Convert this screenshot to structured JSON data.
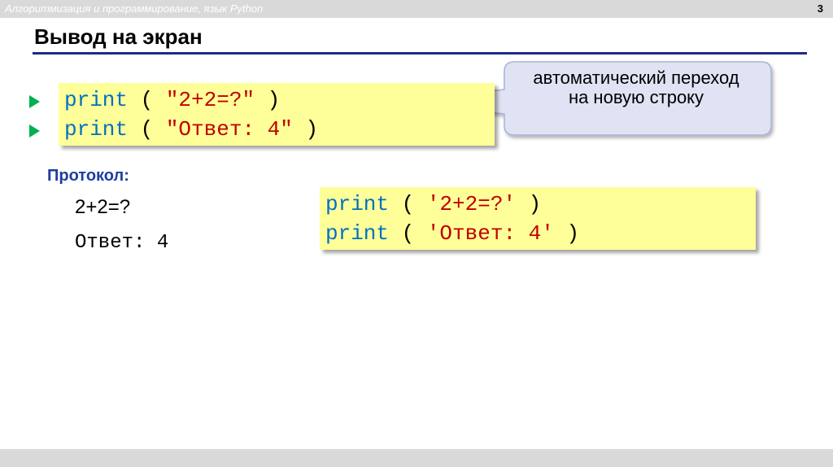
{
  "header": {
    "course_title": "Алгоритмизация и программирование, язык Python",
    "page_number": "3"
  },
  "slide": {
    "title": "Вывод на экран"
  },
  "code_main": {
    "line1": {
      "kw": "print",
      "open": " ( ",
      "str": "\"2+2=?\"",
      "close": " )"
    },
    "line2": {
      "kw": "print",
      "open": " ( ",
      "str": "\"Ответ: 4\"",
      "close": " )"
    }
  },
  "callout": {
    "line1": "автоматический переход",
    "line2": "на новую строку"
  },
  "protocol": {
    "label": "Протокол:",
    "output_line1": "2+2=?",
    "output_line2": "Ответ: 4"
  },
  "code_alt": {
    "line1": {
      "kw": "print",
      "open": " ( ",
      "str": "'2+2=?'",
      "close": " )"
    },
    "line2": {
      "kw": "print",
      "open": " ( ",
      "str": "'Ответ: 4'",
      "close": " )"
    }
  },
  "colors": {
    "keyword": "#0070c0",
    "string": "#c00000",
    "code_bg": "#ffff99",
    "bullet": "#00b050",
    "accent": "#1f2a8a",
    "protocol_label": "#1f3ea1"
  },
  "icons": {
    "bullet": "play-triangle-icon"
  }
}
